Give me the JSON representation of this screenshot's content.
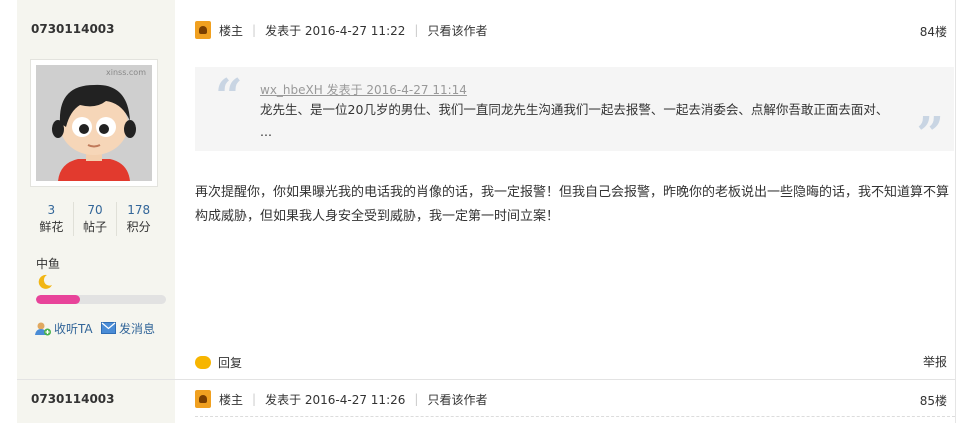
{
  "posts": [
    {
      "username": "0730114003",
      "role_label": "楼主",
      "posted": "发表于 2016-4-27 11:22",
      "only_author": "只看该作者",
      "floor": "84楼",
      "quote": {
        "author": "wx_hbeXH 发表于 2016-4-27 11:14",
        "text": "龙先生、是一位20几岁的男仕、我们一直同龙先生沟通我们一起去报警、一起去消委会、点解你吾敢正面去面对、 ..."
      },
      "body": "再次提醒你，你如果曝光我的电话我的肖像的话，我一定报警！但我自己会报警，昨晚你的老板说出一些隐晦的话，我不知道算不算构成威胁，但如果我人身安全受到威胁，我一定第一时间立案！",
      "reply_label": "回复",
      "report_label": "举报"
    },
    {
      "username": "0730114003",
      "role_label": "楼主",
      "posted": "发表于 2016-4-27 11:26",
      "only_author": "只看该作者",
      "floor": "85楼"
    }
  ],
  "profile": {
    "avatar_watermark": "xinss.com",
    "stats": [
      {
        "value": "3",
        "label": "鲜花"
      },
      {
        "value": "70",
        "label": "帖子"
      },
      {
        "value": "178",
        "label": "积分"
      }
    ],
    "level_name": "中鱼",
    "level_progress": 0.34,
    "follow_label": "收听TA",
    "message_label": "发消息"
  },
  "colors": {
    "sidebar_bg": "#f5f5ef",
    "link": "#336699",
    "progress": "#e8449a",
    "quote_bg": "#f5f5f5",
    "quote_mark": "#c9d5e3"
  }
}
